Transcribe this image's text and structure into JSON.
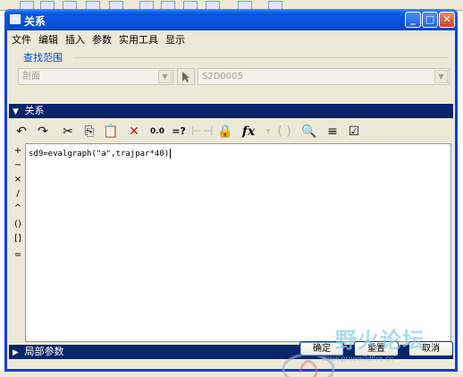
{
  "window": {
    "title": "关系"
  },
  "menu": [
    "文件",
    "编辑",
    "插入",
    "参数",
    "实用工具",
    "显示"
  ],
  "search_scope": {
    "label": "查找范围",
    "type_value": "剖面",
    "selection_value": "S2D0005"
  },
  "relations_section": {
    "label": "关系"
  },
  "toolbar": {
    "icons": [
      "undo-icon",
      "redo-icon",
      "cut-icon",
      "copy-icon",
      "paste-icon",
      "delete-icon",
      "unit-convert-icon",
      "evaluate-icon",
      "dimension-icon",
      "lock-icon",
      "function-icon",
      "parameter-icon",
      "search-icon",
      "sort-icon",
      "verify-icon"
    ]
  },
  "operators": [
    "+",
    "−",
    "×",
    "/",
    "^",
    "()",
    "[]",
    "="
  ],
  "editor": {
    "text": "sd9=evalgraph(\"a\",trajpar*40)"
  },
  "local_params_section": {
    "label": "局部参数"
  },
  "buttons": {
    "ok": "确定",
    "reset": "重置",
    "cancel": "取消"
  },
  "watermark": {
    "text": "野火论坛",
    "sub": "www.proewildfire.cn"
  },
  "colors": {
    "titlebar": "#0553dc",
    "section_bar": "#0a246a",
    "face": "#ece9d8"
  }
}
